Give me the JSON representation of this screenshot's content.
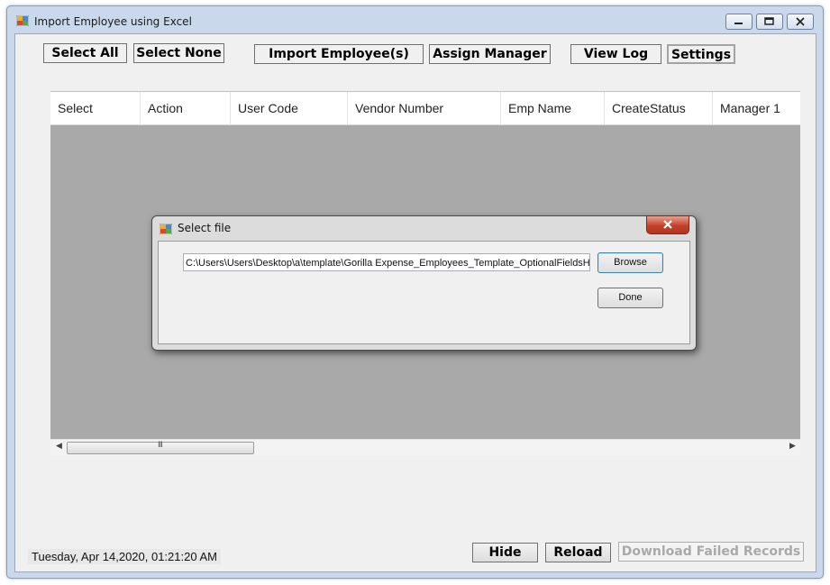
{
  "window": {
    "title": "Import Employee using Excel",
    "controls": [
      "minimize-icon",
      "maximize-icon",
      "close-icon"
    ]
  },
  "toolbar": {
    "select_all": "Select All",
    "select_none": "Select None",
    "import_employees": "Import Employee(s)",
    "assign_manager": "Assign Manager",
    "view_log": "View Log",
    "settings": "Settings"
  },
  "grid": {
    "columns": [
      "Select",
      "Action",
      "User Code",
      "Vendor Number",
      "Emp Name",
      "CreateStatus",
      "Manager 1"
    ],
    "scroll_grip": "III"
  },
  "dialog": {
    "title": "Select file",
    "file_path": "C:\\Users\\Users\\Desktop\\a\\template\\Gorilla Expense_Employees_Template_OptionalFieldsHic",
    "browse_label": "Browse",
    "done_label": "Done"
  },
  "footer": {
    "datetime": "Tuesday, Apr 14,2020, 01:21:20 AM",
    "hide_label": "Hide",
    "reload_label": "Reload",
    "download_failed_label": "Download Failed Records"
  }
}
